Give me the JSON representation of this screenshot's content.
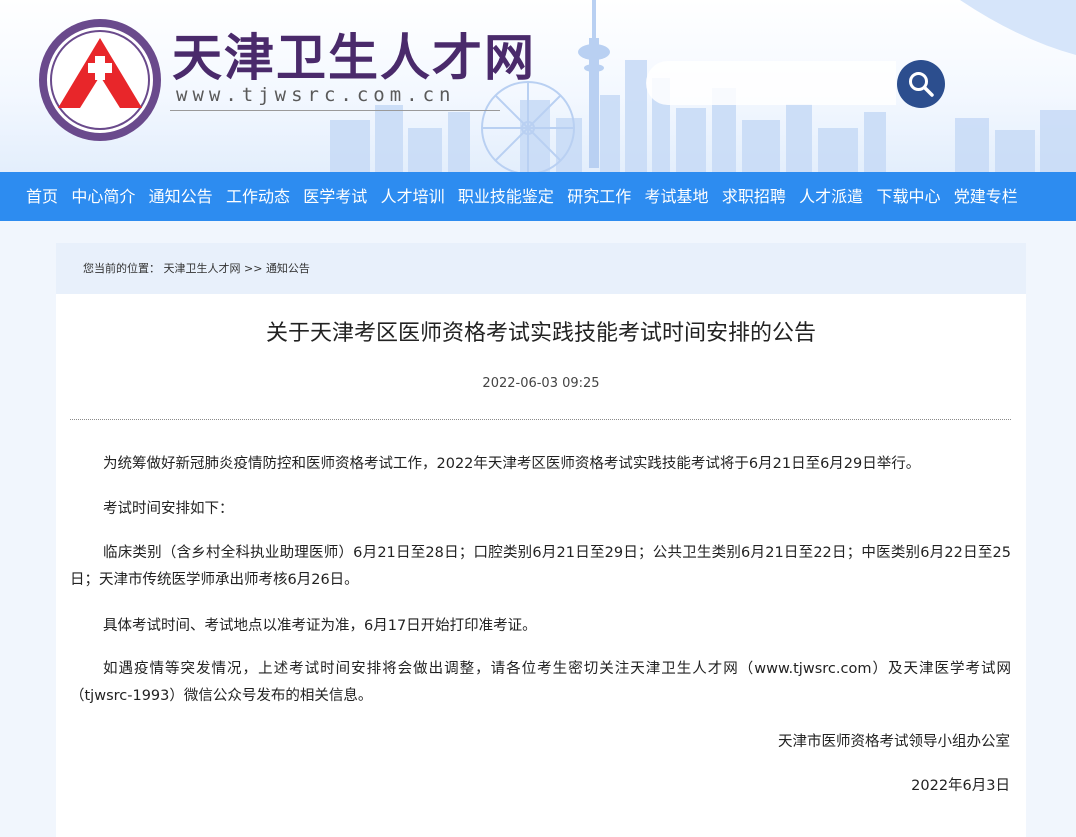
{
  "header": {
    "site_title": "天津卫生人才网",
    "site_url": "www.tjwsrc.com.cn",
    "logo_icon": "cross-house-logo-icon",
    "search": {
      "placeholder": "",
      "value": "",
      "button_icon": "search-icon"
    }
  },
  "nav": {
    "items": [
      {
        "label": "首页"
      },
      {
        "label": "中心简介"
      },
      {
        "label": "通知公告"
      },
      {
        "label": "工作动态"
      },
      {
        "label": "医学考试"
      },
      {
        "label": "人才培训"
      },
      {
        "label": "职业技能鉴定"
      },
      {
        "label": "研究工作"
      },
      {
        "label": "考试基地"
      },
      {
        "label": "求职招聘"
      },
      {
        "label": "人才派遣"
      },
      {
        "label": "下载中心"
      },
      {
        "label": "党建专栏"
      }
    ]
  },
  "breadcrumb": {
    "prefix": "您当前的位置：",
    "home": "天津卫生人才网",
    "separator": ">>",
    "current": "通知公告"
  },
  "article": {
    "title": "关于天津考区医师资格考试实践技能考试时间安排的公告",
    "date": "2022-06-03 09:25",
    "paragraphs": [
      "为统筹做好新冠肺炎疫情防控和医师资格考试工作，2022年天津考区医师资格考试实践技能考试将于6月21日至6月29日举行。",
      "考试时间安排如下：",
      "临床类别（含乡村全科执业助理医师）6月21日至28日；口腔类别6月21日至29日；公共卫生类别6月21日至22日；中医类别6月22日至25日；天津市传统医学师承出师考核6月26日。",
      "具体考试时间、考试地点以准考证为准，6月17日开始打印准考证。",
      "如遇疫情等突发情况，上述考试时间安排将会做出调整，请各位考生密切关注天津卫生人才网（www.tjwsrc.com）及天津医学考试网（tjwsrc-1993）微信公众号发布的相关信息。"
    ],
    "signature": "天津市医师资格考试领导小组办公室",
    "signature_date": "2022年6月3日"
  },
  "colors": {
    "nav_bg": "#2d8cf0",
    "title_purple": "#4a2a6b",
    "logo_red": "#e8262a",
    "search_button": "#2c4e8e",
    "breadcrumb_bg": "#e8f0fb"
  }
}
